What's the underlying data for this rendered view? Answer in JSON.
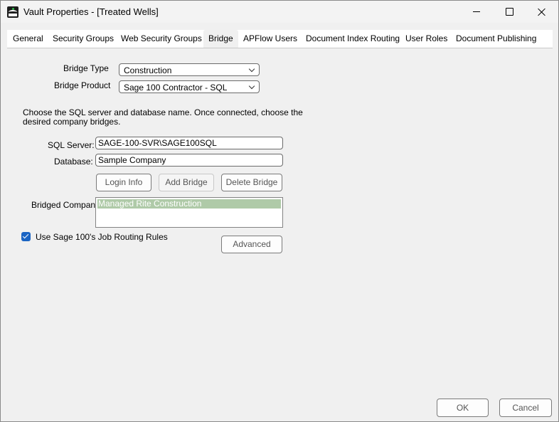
{
  "window": {
    "title": "Vault Properties - [Treated Wells]",
    "icon": "spc-app-icon",
    "controls": [
      "minimize-icon",
      "maximize-icon",
      "close-icon"
    ]
  },
  "tabs": [
    {
      "label": "General",
      "active": false
    },
    {
      "label": "Security Groups",
      "active": false
    },
    {
      "label": "Web Security Groups",
      "active": false
    },
    {
      "label": "Bridge",
      "active": true
    },
    {
      "label": "APFlow Users",
      "active": false
    },
    {
      "label": "Document Index Routing",
      "active": false
    },
    {
      "label": "User Roles",
      "active": false
    },
    {
      "label": "Document Publishing",
      "active": false
    }
  ],
  "bridge": {
    "bridge_type_label": "Bridge Type",
    "bridge_type_value": "Construction",
    "bridge_product_label": "Bridge Product",
    "bridge_product_value": "Sage 100 Contractor - SQL",
    "instructions_line1": "Choose the SQL server and database name.  Once connected, choose the",
    "instructions_line2": "desired company bridges.",
    "sql_server_label": "SQL Server:",
    "sql_server_value": "SAGE-100-SVR\\SAGE100SQL",
    "database_label": "Database:",
    "database_value": "Sample Company",
    "login_info_button": "Login Info",
    "add_bridge_button": "Add Bridge",
    "delete_bridge_button": "Delete Bridge",
    "bridged_company_label": "Bridged Company:",
    "bridged_companies": [
      "Managed Rite Construction"
    ],
    "job_routing_checkbox_label": "Use Sage 100's Job Routing Rules",
    "job_routing_checked": true,
    "advanced_button": "Advanced"
  },
  "footer": {
    "ok_button": "OK",
    "cancel_button": "Cancel"
  },
  "colors": {
    "selected_item_bg": "#afcaa8",
    "checkbox_accent": "#1a64c3"
  }
}
